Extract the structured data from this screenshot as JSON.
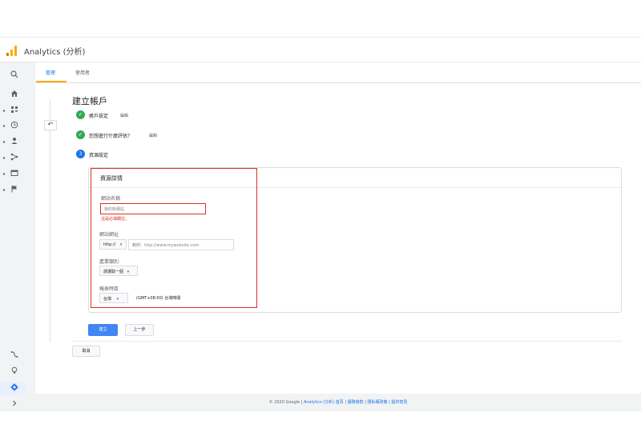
{
  "app": {
    "name": "Analytics (分析)"
  },
  "tabs": [
    {
      "label": "管理"
    },
    {
      "label": "使用者"
    }
  ],
  "page": {
    "title": "建立帳戶"
  },
  "steps": [
    {
      "label": "帳戶設定",
      "edit": "編輯",
      "state": "done"
    },
    {
      "label": "您想進行什麼評估？",
      "edit": "編輯",
      "state": "done"
    },
    {
      "label": "資源設定",
      "number": "3",
      "state": "current"
    }
  ],
  "property": {
    "section_title": "資源詳情",
    "site_name_label": "網站名稱",
    "site_name_placeholder": "我的新網站",
    "site_name_error": "這是必填欄位。",
    "url_label": "網站網址",
    "protocol": "http://",
    "url_placeholder": "範例：http://www.mywebsite.com",
    "industry_label": "產業類別",
    "industry_value": "請選取一個",
    "timezone_label": "報表時區",
    "country_value": "台灣",
    "timezone_value": "(GMT+08:00) 台灣時間"
  },
  "buttons": {
    "create": "建立",
    "previous": "上一步",
    "cancel": "取消"
  },
  "footer": {
    "copyright": "© 2020 Google |",
    "links": [
      "Analytics (分析) 首頁",
      "服務條款",
      "隱私權政策",
      "提供意見"
    ],
    "sep": " | "
  },
  "colors": {
    "accent": "#1a73e8",
    "error": "#d93025",
    "success": "#34a853",
    "tab_indicator": "#f9ab00"
  }
}
